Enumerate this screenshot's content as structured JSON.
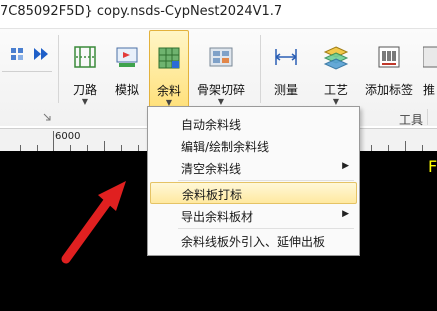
{
  "window": {
    "title": "7C85092F5D} copy.nsds-CypNest2024V1.7"
  },
  "ribbon": {
    "buttons": [
      {
        "label": "刀路",
        "icon": "toolpath-icon",
        "has_dropdown": true
      },
      {
        "label": "模拟",
        "icon": "simulate-icon",
        "has_dropdown": false
      },
      {
        "label": "余料",
        "icon": "remnant-icon",
        "has_dropdown": true,
        "active": true
      },
      {
        "label": "骨架切碎",
        "icon": "skeleton-cut-icon",
        "has_dropdown": true
      },
      {
        "label": "测量",
        "icon": "measure-icon",
        "has_dropdown": false
      },
      {
        "label": "工艺",
        "icon": "process-icon",
        "has_dropdown": true
      },
      {
        "label": "添加标签",
        "icon": "add-label-icon",
        "has_dropdown": false
      },
      {
        "label": "推",
        "icon": "push-icon",
        "has_dropdown": false
      }
    ],
    "group_label": "工具"
  },
  "ruler": {
    "label": "6000"
  },
  "canvas": {
    "text": "F"
  },
  "remnant_menu": {
    "items": [
      {
        "label": "自动余料线",
        "submenu": false
      },
      {
        "label": "编辑/绘制余料线",
        "submenu": false
      },
      {
        "label": "清空余料线",
        "submenu": true
      },
      {
        "label": "余料板打标",
        "submenu": false,
        "highlighted": true
      },
      {
        "label": "导出余料板材",
        "submenu": true
      },
      {
        "label": "余料线板外引入、延伸出板",
        "submenu": false
      }
    ],
    "submenu_arrow": "▶"
  },
  "colors": {
    "highlight": "#ffe9a0",
    "active_button": "#ffe07a",
    "canvas": "#000000",
    "annotation_arrow": "#e02020",
    "canvas_text": "#ffff00"
  }
}
